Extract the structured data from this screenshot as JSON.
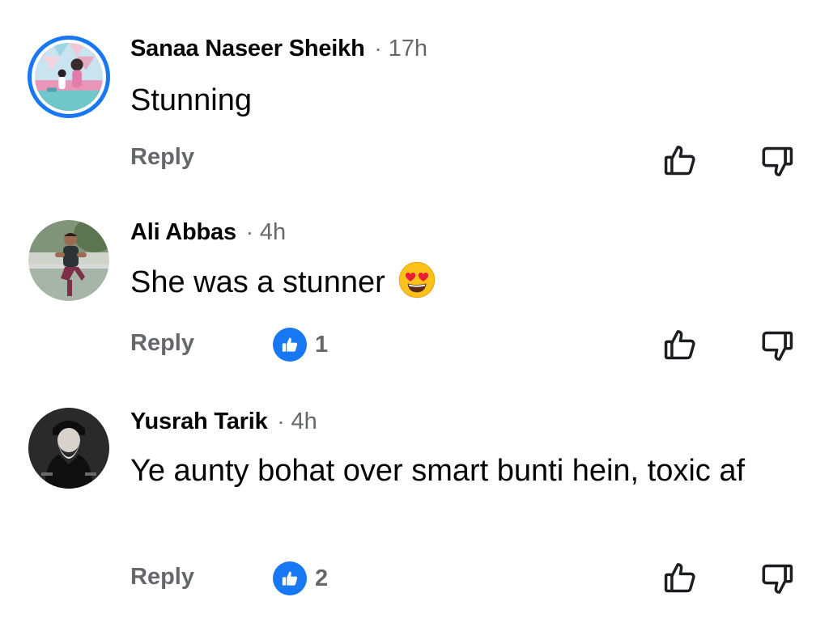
{
  "comments": [
    {
      "author": "Sanaa Naseer Sheikh",
      "separator": "·",
      "time": "17h",
      "text": "Stunning",
      "emoji": "",
      "reply_label": "Reply",
      "like_count": null,
      "avatar": "story-ring-avatar"
    },
    {
      "author": "Ali Abbas",
      "separator": "·",
      "time": "4h",
      "text": "She was a stunner",
      "emoji": "heart-eyes-emoji",
      "reply_label": "Reply",
      "like_count": "1",
      "avatar": "photo-avatar"
    },
    {
      "author": "Yusrah Tarik",
      "separator": "·",
      "time": "4h",
      "text": "Ye aunty bohat over smart bunti hein, toxic af",
      "emoji": "",
      "reply_label": "Reply",
      "like_count": "2",
      "avatar": "photo-avatar"
    }
  ],
  "colors": {
    "accent": "#1877f2",
    "secondary_text": "#65676b",
    "primary_text": "#050505"
  },
  "icons": {
    "like_button": "thumbs-up-outline-icon",
    "dislike_button": "thumbs-down-outline-icon",
    "like_badge": "like-reaction-icon"
  }
}
